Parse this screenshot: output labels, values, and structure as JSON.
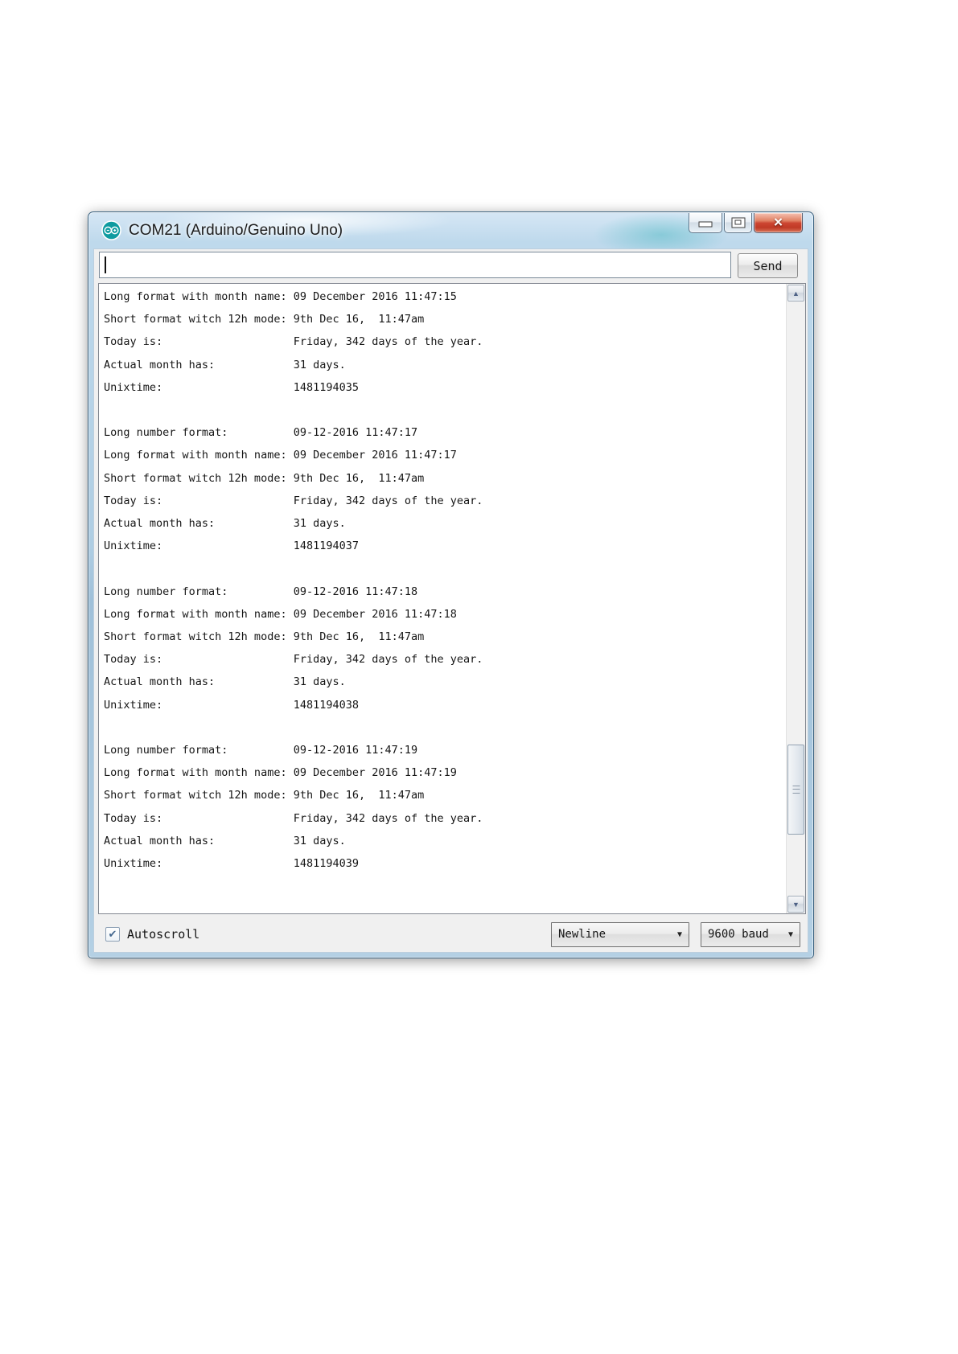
{
  "window": {
    "title": "COM21 (Arduino/Genuino Uno)"
  },
  "toolbar": {
    "input_value": "",
    "input_placeholder": "",
    "send_label": "Send"
  },
  "console": {
    "label_pad": 29,
    "blocks": [
      {
        "lines": [
          {
            "label": "Long format with month name:",
            "value": "09 December 2016 11:47:15"
          },
          {
            "label": "Short format witch 12h mode:",
            "value": "9th Dec 16,  11:47am"
          },
          {
            "label": "Today is:",
            "value": "Friday, 342 days of the year."
          },
          {
            "label": "Actual month has:",
            "value": "31 days."
          },
          {
            "label": "Unixtime:",
            "value": "1481194035"
          }
        ]
      },
      {
        "lines": [
          {
            "label": "Long number format:",
            "value": "09-12-2016 11:47:17"
          },
          {
            "label": "Long format with month name:",
            "value": "09 December 2016 11:47:17"
          },
          {
            "label": "Short format witch 12h mode:",
            "value": "9th Dec 16,  11:47am"
          },
          {
            "label": "Today is:",
            "value": "Friday, 342 days of the year."
          },
          {
            "label": "Actual month has:",
            "value": "31 days."
          },
          {
            "label": "Unixtime:",
            "value": "1481194037"
          }
        ]
      },
      {
        "lines": [
          {
            "label": "Long number format:",
            "value": "09-12-2016 11:47:18"
          },
          {
            "label": "Long format with month name:",
            "value": "09 December 2016 11:47:18"
          },
          {
            "label": "Short format witch 12h mode:",
            "value": "9th Dec 16,  11:47am"
          },
          {
            "label": "Today is:",
            "value": "Friday, 342 days of the year."
          },
          {
            "label": "Actual month has:",
            "value": "31 days."
          },
          {
            "label": "Unixtime:",
            "value": "1481194038"
          }
        ]
      },
      {
        "lines": [
          {
            "label": "Long number format:",
            "value": "09-12-2016 11:47:19"
          },
          {
            "label": "Long format with month name:",
            "value": "09 December 2016 11:47:19"
          },
          {
            "label": "Short format witch 12h mode:",
            "value": "9th Dec 16,  11:47am"
          },
          {
            "label": "Today is:",
            "value": "Friday, 342 days of the year."
          },
          {
            "label": "Actual month has:",
            "value": "31 days."
          },
          {
            "label": "Unixtime:",
            "value": "1481194039"
          }
        ]
      }
    ]
  },
  "status_bar": {
    "autoscroll_label": "Autoscroll",
    "autoscroll_checked": true,
    "line_ending_selected": "Newline",
    "baud_selected": "9600 baud"
  },
  "icons": {
    "close_glyph": "✕",
    "chevron_down": "▼",
    "scroll_up": "▲",
    "scroll_down": "▼",
    "check": "✔"
  },
  "colors": {
    "arduino_teal": "#0f9ba0",
    "titlebar_blue": "#aecde3",
    "close_red": "#cc4531",
    "client_gray": "#f0f0f0",
    "console_text": "#161616"
  }
}
